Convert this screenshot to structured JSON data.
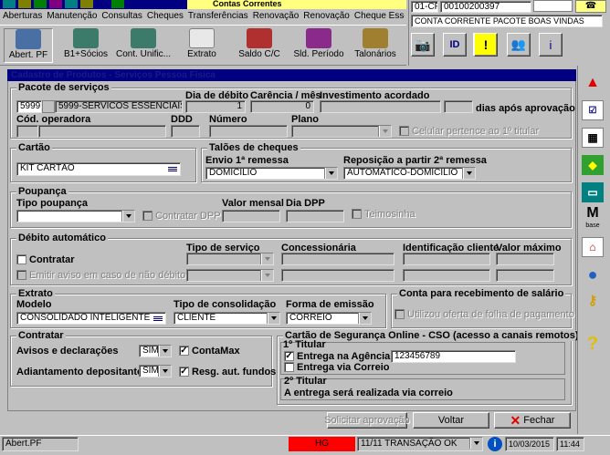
{
  "window": {
    "title": "Contas Correntes"
  },
  "menu": {
    "items": [
      "Aberturas",
      "Manutenção",
      "Consultas",
      "Cheques",
      "Transferências",
      "Renovação",
      "Renovação",
      "Cheque Essencial"
    ]
  },
  "header_right": {
    "code1": "01-CF",
    "code2": "00100200397",
    "account_type": "CONTA CORRENTE PACOTE BOAS VINDAS"
  },
  "toolbar": {
    "items": [
      "Abert. PF",
      "B1+Sócios",
      "Cont. Unific...",
      "Extrato",
      "Saldo C/C",
      "Sld. Período",
      "Talonários"
    ]
  },
  "form_title": "Cadastro de Produtos - Serviços Pessoa Física",
  "pacote": {
    "legend": "Pacote de serviços",
    "code": "5999",
    "name": "5999-SERVICOS ESSENCIAIS",
    "dia_debito_label": "Dia de débito",
    "dia_debito": "1",
    "carencia_label": "Carência / mês",
    "carencia": "0",
    "investimento_label": "Investimento acordado",
    "dias_apos": "dias após aprovação",
    "cod_operadora_label": "Cód. operadora",
    "ddd_label": "DDD",
    "numero_label": "Número",
    "plano_label": "Plano",
    "celular_label": "Celular pertence ao 1º titular"
  },
  "cartao": {
    "legend": "Cartão",
    "value": "KIT CARTÃO"
  },
  "taloes": {
    "legend": "Talões de cheques",
    "envio_label": "Envio 1ª remessa",
    "envio": "DOMICILIO",
    "reposicao_label": "Reposição a partir 2ª remessa",
    "reposicao": "AUTOMATICO-DOMICILIO"
  },
  "poupanca": {
    "legend": "Poupança",
    "tipo_label": "Tipo poupança",
    "contratar_dpp": "Contratar DPP",
    "valor_mensal_label": "Valor mensal",
    "dia_dpp_label": "Dia DPP",
    "teimosinha": "Teimosinha"
  },
  "debito": {
    "legend": "Débito automático",
    "contratar": "Contratar",
    "aviso": "Emitir aviso em caso de não débito",
    "tipo_servico_label": "Tipo de serviço",
    "concessionaria_label": "Concessionária",
    "id_cliente_label": "Identificação cliente",
    "valor_maximo_label": "Valor máximo"
  },
  "extrato": {
    "legend": "Extrato",
    "modelo_label": "Modelo",
    "modelo": "CONSOLIDADO INTELIGENTE",
    "consolidacao_label": "Tipo de consolidação",
    "consolidacao": "CLIENTE",
    "emissao_label": "Forma de emissão",
    "emissao": "CORREIO"
  },
  "salario": {
    "legend": "Conta para recebimento de salário",
    "oferta": "Utilizou oferta de folha de pagamento"
  },
  "contratar": {
    "legend": "Contratar",
    "avisos_label": "Avisos e declarações",
    "avisos": "SIM",
    "contamax": "ContaMax",
    "adiantamento_label": "Adiantamento depositante",
    "adiantamento": "SIM",
    "resg": "Resg. aut. fundos"
  },
  "cso": {
    "legend": "Cartão de Segurança Online - CSO (acesso a canais remotos)",
    "titular1": "1º Titular",
    "entrega_agencia": "Entrega na Agência",
    "agencia_value": "123456789",
    "entrega_correio": "Entrega via Correio",
    "titular2": "2º Titular",
    "info2": "A entrega será realizada via correio"
  },
  "buttons": {
    "solicitar": "Solicitar aprovação",
    "voltar": "Voltar",
    "fechar": "Fechar"
  },
  "status": {
    "left": "Abert.PF",
    "hg": "HG",
    "transacao": "11/11 TRANSAÇÃO  OK",
    "date": "10/03/2015",
    "time": "11:44"
  },
  "colors": {
    "titlebar": "#000080",
    "hg": "#ff0000",
    "accent_yellow": "#ffff80"
  }
}
